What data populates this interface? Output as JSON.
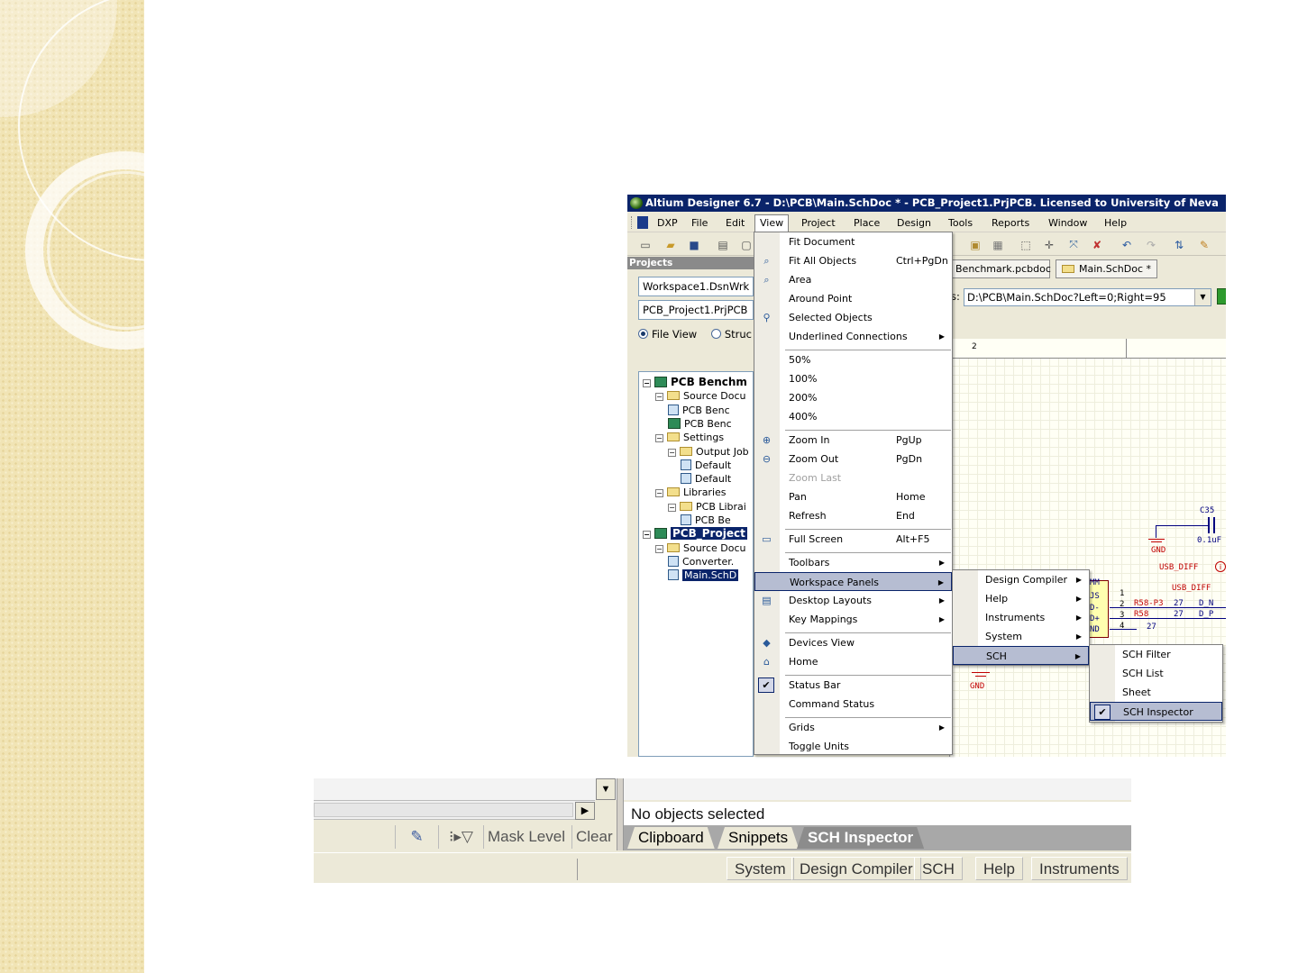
{
  "app_window": {
    "title": "Altium Designer 6.7 - D:\\PCB\\Main.SchDoc * - PCB_Project1.PrjPCB. Licensed to University of Neva",
    "menu": [
      "DXP",
      "File",
      "Edit",
      "View",
      "Project",
      "Place",
      "Design",
      "Tools",
      "Reports",
      "Window",
      "Help"
    ],
    "active_menu": "View"
  },
  "projects_panel": {
    "header": "Projects",
    "workspace_combo": "Workspace1.DsnWrk",
    "project_combo": "PCB_Project1.PrjPCB",
    "radio_file_view": "File View",
    "radio_structure": "Struc",
    "tree": [
      {
        "label": "PCB Benchm",
        "level": 0,
        "kind": "project",
        "bold": true
      },
      {
        "label": "Source Docu",
        "level": 1,
        "kind": "folder"
      },
      {
        "label": "PCB Benc",
        "level": 2,
        "kind": "doc"
      },
      {
        "label": "PCB Benc",
        "level": 2,
        "kind": "pcb"
      },
      {
        "label": "Settings",
        "level": 1,
        "kind": "folder"
      },
      {
        "label": "Output Job",
        "level": 2,
        "kind": "folder"
      },
      {
        "label": "Default",
        "level": 3,
        "kind": "doc"
      },
      {
        "label": "Default",
        "level": 3,
        "kind": "doc"
      },
      {
        "label": "Libraries",
        "level": 1,
        "kind": "folder"
      },
      {
        "label": "PCB Librai",
        "level": 2,
        "kind": "folder"
      },
      {
        "label": "PCB Be",
        "level": 3,
        "kind": "doc"
      },
      {
        "label": "PCB_Project",
        "level": 0,
        "kind": "project",
        "bold": true,
        "selected": true
      },
      {
        "label": "Source Docu",
        "level": 1,
        "kind": "folder"
      },
      {
        "label": "Converter.",
        "level": 2,
        "kind": "doc"
      },
      {
        "label": "Main.SchD",
        "level": 2,
        "kind": "doc",
        "selected": true
      }
    ]
  },
  "document": {
    "tabs": [
      "Benchmark.pcbdoc",
      "Main.SchDoc *"
    ],
    "address_prefix": "s:",
    "address": "D:\\PCB\\Main.SchDoc?Left=0;Right=95",
    "ruler_label": "2",
    "schematic_labels": {
      "c35": "C35",
      "c35_val": "0.1uF",
      "gnd1": "GND",
      "gnd2": "GND",
      "usb_diff1": "USB_DIFF",
      "usb_diff2": "USB_DIFF",
      "d_n": "D_N",
      "d_p": "D_P",
      "r58a": "R58-P3",
      "r58b": "R58",
      "r27a": "27",
      "r27b": "27",
      "r27c": "27",
      "pin1": "1",
      "pin2": "2",
      "pin3": "3",
      "pin4": "4",
      "conn_a": "MM",
      "conn_b": "JS",
      "conn_c": "D-",
      "conn_d": "D+",
      "conn_e": "ND"
    }
  },
  "view_menu": {
    "items": [
      {
        "label": "Fit Document"
      },
      {
        "label": "Fit All Objects",
        "shortcut": "Ctrl+PgDn",
        "icon": "fit-all-icon"
      },
      {
        "label": "Area",
        "icon": "zoom-area-icon"
      },
      {
        "label": "Around Point"
      },
      {
        "label": "Selected Objects",
        "icon": "zoom-selected-icon"
      },
      {
        "label": "Underlined Connections",
        "submenu": true
      },
      {
        "separator": true
      },
      {
        "label": "50%"
      },
      {
        "label": "100%"
      },
      {
        "label": "200%"
      },
      {
        "label": "400%"
      },
      {
        "separator": true
      },
      {
        "label": "Zoom In",
        "shortcut": "PgUp",
        "icon": "zoom-in-icon"
      },
      {
        "label": "Zoom Out",
        "shortcut": "PgDn",
        "icon": "zoom-out-icon"
      },
      {
        "label": "Zoom Last",
        "disabled": true
      },
      {
        "label": "Pan",
        "shortcut": "Home"
      },
      {
        "label": "Refresh",
        "shortcut": "End"
      },
      {
        "separator": true
      },
      {
        "label": "Full Screen",
        "shortcut": "Alt+F5",
        "icon": "full-screen-icon"
      },
      {
        "separator": true
      },
      {
        "label": "Toolbars",
        "submenu": true
      },
      {
        "label": "Workspace Panels",
        "submenu": true,
        "highlighted": true
      },
      {
        "label": "Desktop Layouts",
        "submenu": true,
        "icon": "desktop-layout-icon"
      },
      {
        "label": "Key Mappings",
        "submenu": true
      },
      {
        "separator": true
      },
      {
        "label": "Devices View",
        "icon": "devices-view-icon"
      },
      {
        "label": "Home",
        "icon": "home-icon"
      },
      {
        "separator": true
      },
      {
        "label": "Status Bar",
        "checked": true
      },
      {
        "label": "Command Status"
      },
      {
        "separator": true
      },
      {
        "label": "Grids",
        "submenu": true
      },
      {
        "label": "Toggle Units"
      }
    ]
  },
  "workspace_panels_menu": {
    "items": [
      {
        "label": "Design Compiler",
        "submenu": true
      },
      {
        "label": "Help",
        "submenu": true
      },
      {
        "label": "Instruments",
        "submenu": true
      },
      {
        "label": "System",
        "submenu": true
      },
      {
        "label": "SCH",
        "submenu": true,
        "highlighted": true
      }
    ]
  },
  "sch_menu": {
    "items": [
      {
        "label": "SCH Filter"
      },
      {
        "label": "SCH List"
      },
      {
        "label": "Sheet"
      },
      {
        "label": "SCH Inspector",
        "checked": true,
        "highlighted": true
      }
    ]
  },
  "status_strip": {
    "status_text": "No objects selected",
    "tool_labels": [
      "Mask Level",
      "Clear"
    ],
    "tabs": [
      "Clipboard",
      "Snippets",
      "SCH Inspector"
    ],
    "active_tab": "SCH Inspector",
    "panel_buttons": [
      "System",
      "Design Compiler",
      "SCH",
      "Help",
      "Instruments"
    ]
  },
  "colors": {
    "titlebar": "#0a246a",
    "menu_highlight": "#b6bdd2",
    "schematic_red": "#c00000",
    "schematic_navy": "#00007f"
  }
}
